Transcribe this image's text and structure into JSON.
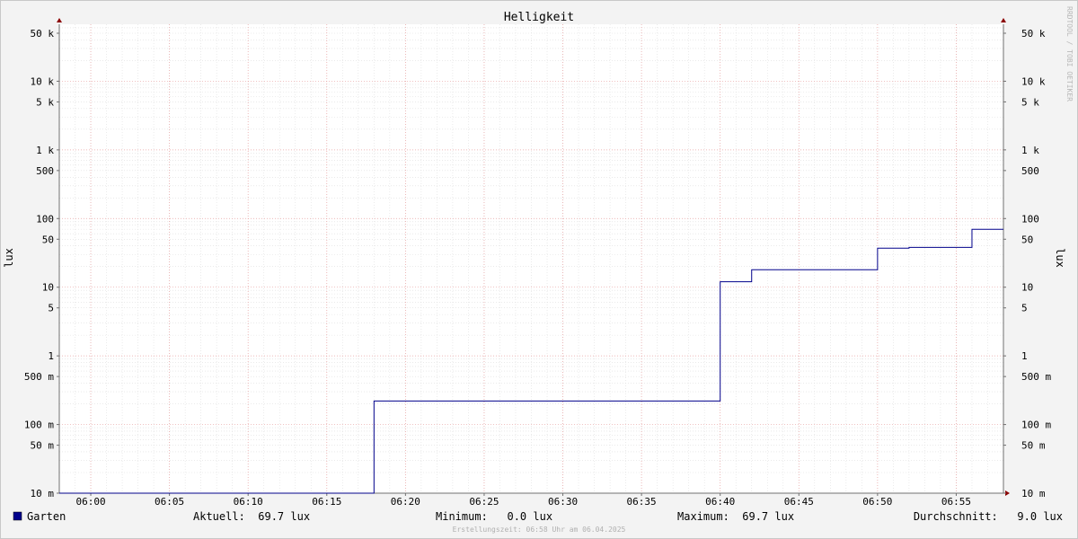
{
  "chart_data": {
    "type": "line",
    "title": "Helligkeit",
    "ylabel_left": "lux",
    "ylabel_right": "lux",
    "watermark": "RRDTOOL / TOBI OETIKER",
    "y_scale": "log",
    "ylim": [
      0.01,
      70000
    ],
    "x_range": [
      "05:58",
      "06:58"
    ],
    "x_ticks": [
      "06:00",
      "06:05",
      "06:10",
      "06:15",
      "06:20",
      "06:25",
      "06:30",
      "06:35",
      "06:40",
      "06:45",
      "06:50",
      "06:55"
    ],
    "y_ticks": [
      {
        "value": 0.01,
        "label": "10 m"
      },
      {
        "value": 0.05,
        "label": "50 m"
      },
      {
        "value": 0.1,
        "label": "100 m"
      },
      {
        "value": 0.5,
        "label": "500 m"
      },
      {
        "value": 1,
        "label": "1"
      },
      {
        "value": 5,
        "label": "5"
      },
      {
        "value": 10,
        "label": "10"
      },
      {
        "value": 50,
        "label": "50"
      },
      {
        "value": 100,
        "label": "100"
      },
      {
        "value": 500,
        "label": "500"
      },
      {
        "value": 1000,
        "label": "1 k"
      },
      {
        "value": 5000,
        "label": "5 k"
      },
      {
        "value": 10000,
        "label": "10 k"
      },
      {
        "value": 50000,
        "label": "50 k"
      }
    ],
    "grid": true,
    "series": [
      {
        "name": "Garten",
        "color": "#00008B",
        "step": true,
        "points": [
          [
            "05:58",
            0.01
          ],
          [
            "06:18",
            0.22
          ],
          [
            "06:40",
            12
          ],
          [
            "06:42",
            18
          ],
          [
            "06:50",
            37
          ],
          [
            "06:52",
            38
          ],
          [
            "06:56",
            69.7
          ],
          [
            "06:58",
            69.7
          ]
        ]
      }
    ]
  },
  "legend": {
    "series_name": "Garten",
    "swatch_color": "#00008B",
    "current": "Aktuell:  69.7 lux",
    "minimum": "Minimum:   0.0 lux",
    "maximum": "Maximum:  69.7 lux",
    "average": "Durchschnitt:   9.0 lux"
  },
  "footer": "Erstellungszeit: 06:58 Uhr am 06.04.2025"
}
